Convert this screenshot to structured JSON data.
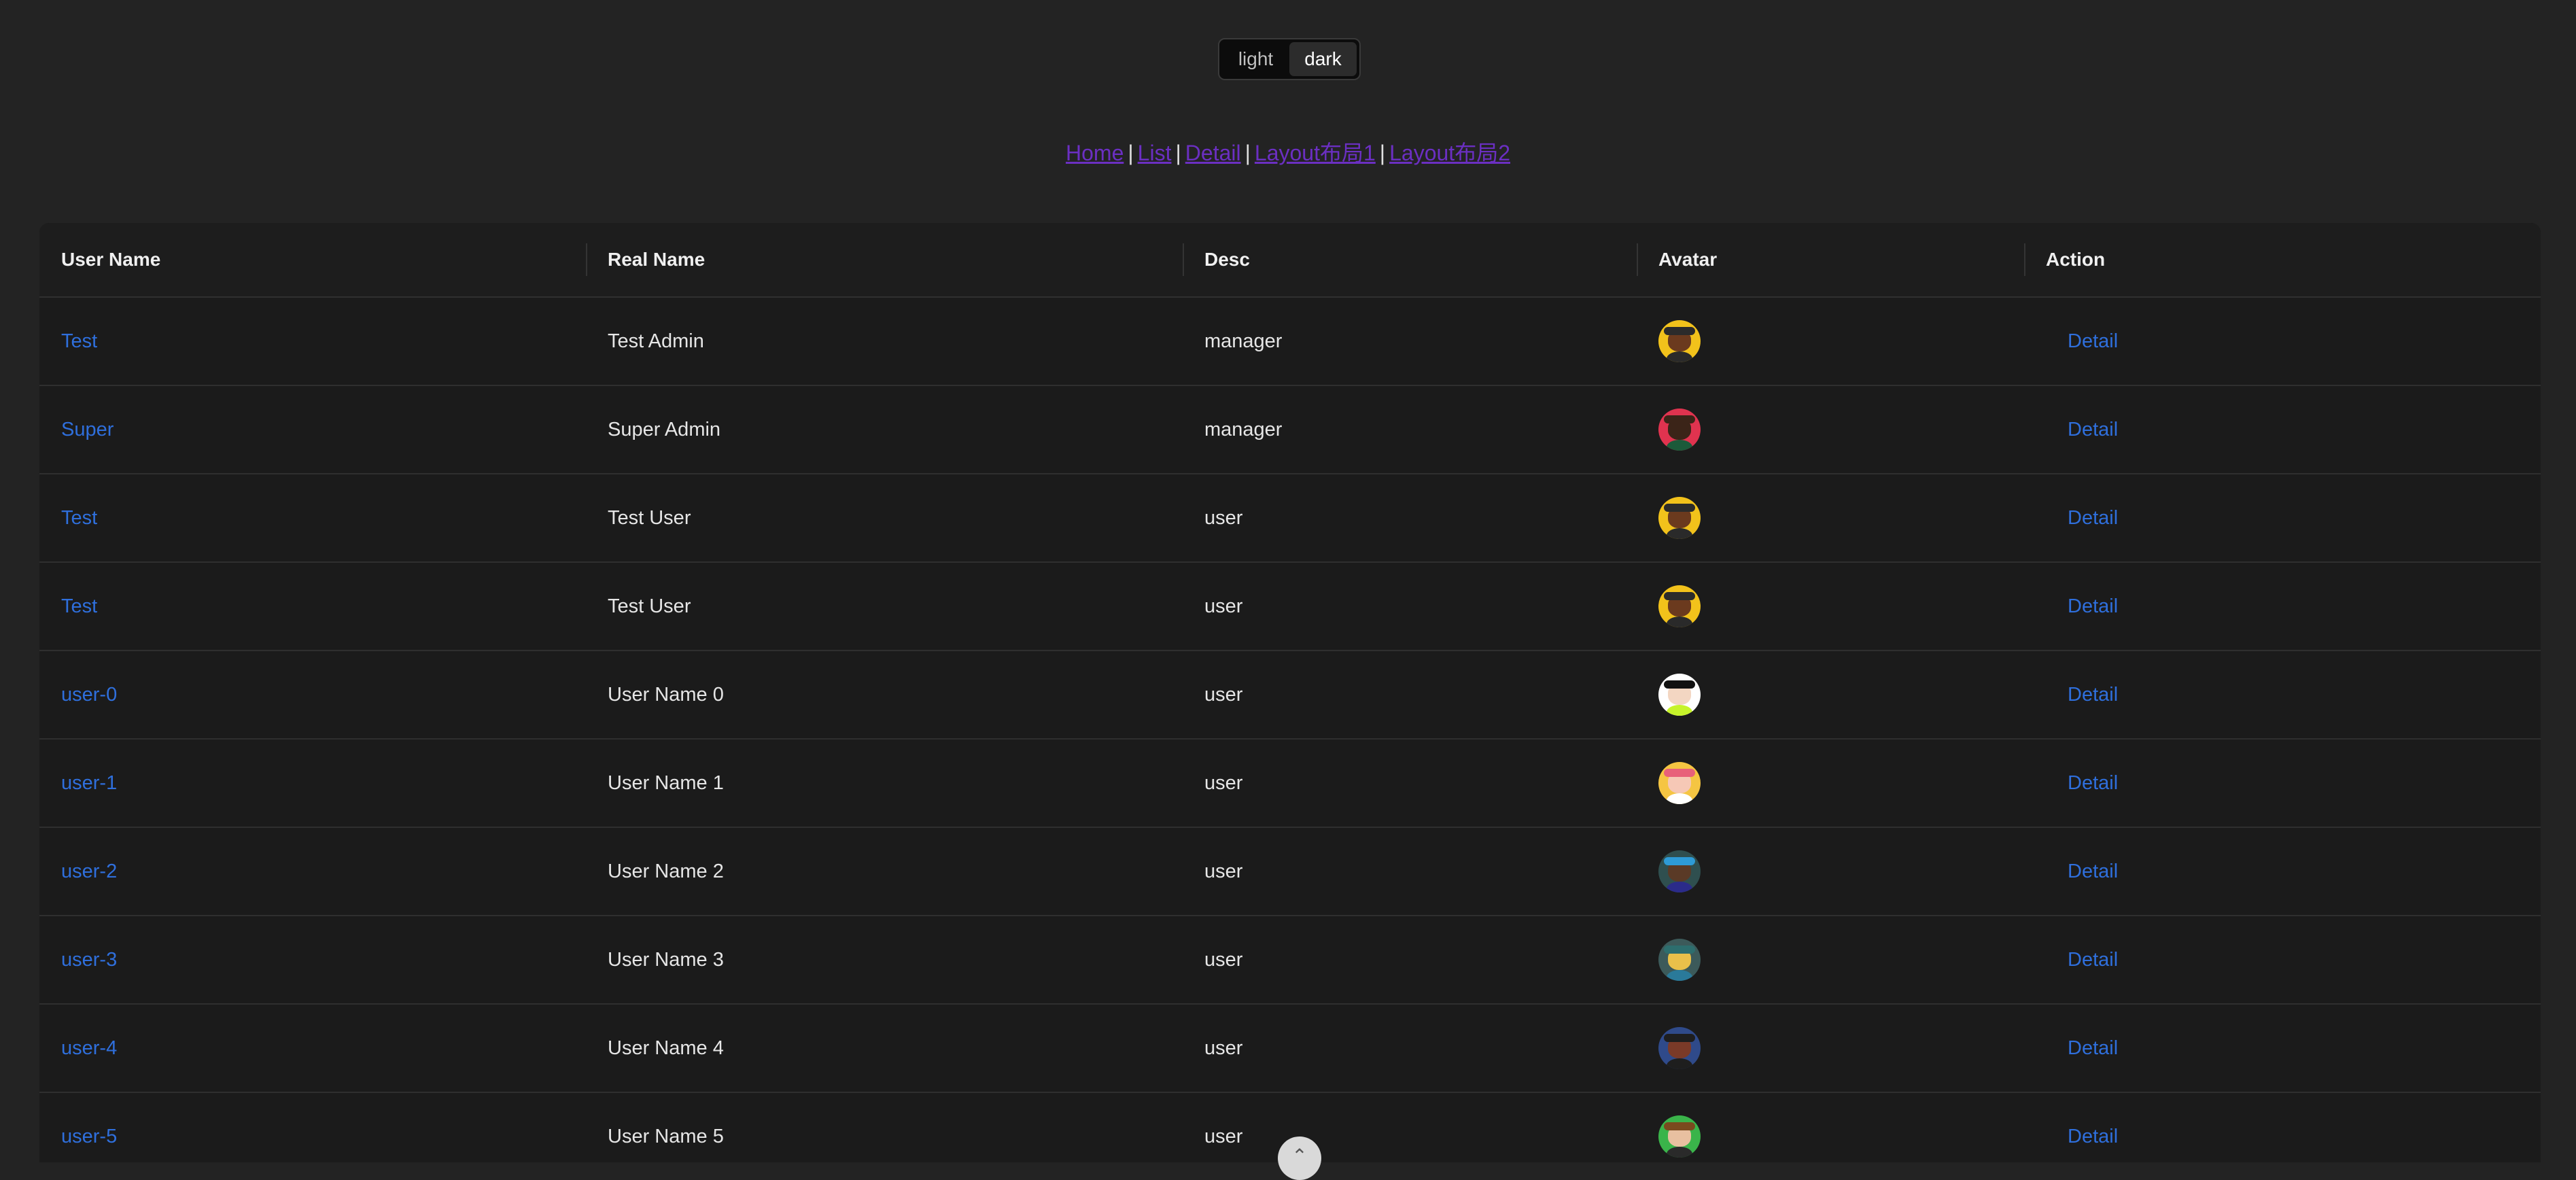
{
  "theme": {
    "options": [
      "light",
      "dark"
    ],
    "selected": "dark"
  },
  "nav": {
    "links": [
      "Home",
      "List",
      "Detail",
      "Layout布局1",
      "Layout布局2"
    ],
    "separator": "|"
  },
  "table": {
    "columns": [
      "User Name",
      "Real Name",
      "Desc",
      "Avatar",
      "Action"
    ],
    "rows": [
      {
        "username": "Test",
        "realname": "Test Admin",
        "desc": "manager",
        "avatar": "avatar-yellow-hat-icon",
        "action": "Detail"
      },
      {
        "username": "Super",
        "realname": "Super Admin",
        "desc": "manager",
        "avatar": "avatar-red-icon",
        "action": "Detail"
      },
      {
        "username": "Test",
        "realname": "Test User",
        "desc": "user",
        "avatar": "avatar-yellow-hat-icon",
        "action": "Detail"
      },
      {
        "username": "Test",
        "realname": "Test User",
        "desc": "user",
        "avatar": "avatar-yellow-hat-icon",
        "action": "Detail"
      },
      {
        "username": "user-0",
        "realname": "User Name 0",
        "desc": "user",
        "avatar": "avatar-lime-icon",
        "action": "Detail"
      },
      {
        "username": "user-1",
        "realname": "User Name 1",
        "desc": "user",
        "avatar": "avatar-pink-bow-icon",
        "action": "Detail"
      },
      {
        "username": "user-2",
        "realname": "User Name 2",
        "desc": "user",
        "avatar": "avatar-dark-teal-icon",
        "action": "Detail"
      },
      {
        "username": "user-3",
        "realname": "User Name 3",
        "desc": "user",
        "avatar": "avatar-glasses-icon",
        "action": "Detail"
      },
      {
        "username": "user-4",
        "realname": "User Name 4",
        "desc": "user",
        "avatar": "avatar-blue-icon",
        "action": "Detail"
      },
      {
        "username": "user-5",
        "realname": "User Name 5",
        "desc": "user",
        "avatar": "avatar-green-icon",
        "action": "Detail"
      }
    ]
  },
  "colors": {
    "background": "#232323",
    "table_background": "#1b1b1b",
    "link": "#2f6fdc",
    "nav_link": "#6b2fc2"
  },
  "back_to_top": {
    "icon": "chevron-up-icon",
    "glyph": "⌃"
  }
}
